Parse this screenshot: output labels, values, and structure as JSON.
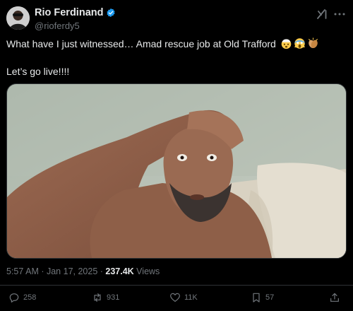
{
  "author": {
    "display_name": "Rio Ferdinand",
    "handle": "@rioferdy5",
    "verified": true
  },
  "header_icons": [
    "grok-icon",
    "more-icon"
  ],
  "tweet": {
    "line1": "What have I just witnessed… Amad rescue job at Old Trafford",
    "line1_emojis": [
      "exploding-head-emoji",
      "screaming-face-emoji",
      "clapping-hands-emoji"
    ],
    "line2": "Let’s go live!!!!"
  },
  "meta": {
    "time": "5:57 AM",
    "separator1": " · ",
    "date": "Jan 17, 2025",
    "separator2": " · ",
    "views_count": "237.4K",
    "views_label": " Views"
  },
  "actions": {
    "replies": "258",
    "reposts": "931",
    "likes": "11K",
    "bookmarks": "57"
  },
  "colors": {
    "background": "#000000",
    "text_primary": "#e7e9ea",
    "text_secondary": "#71767b",
    "verified_blue": "#1d9bf0",
    "divider": "#2f3336"
  }
}
